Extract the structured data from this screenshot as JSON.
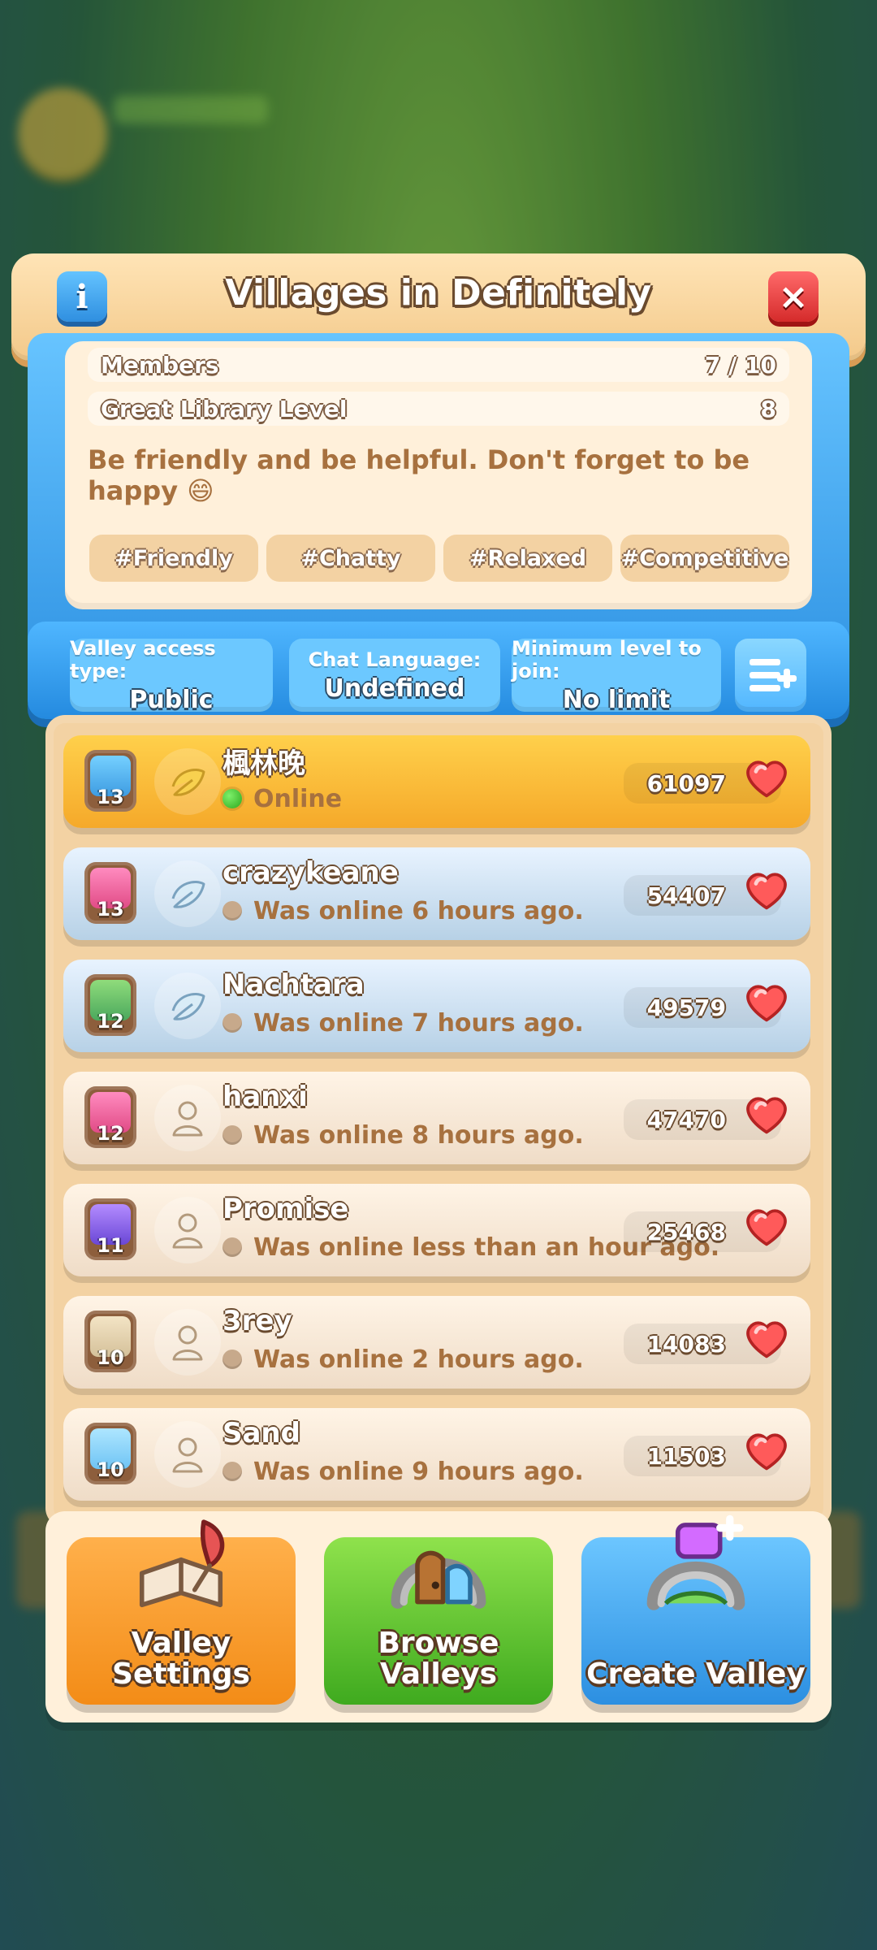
{
  "dialog": {
    "title": "Villages in Definitely",
    "info_button_label": "i",
    "close_button_label": "×",
    "stats": {
      "members_label": "Members",
      "members_value": "7 / 10",
      "library_label": "Great Library Level",
      "library_value": "8"
    },
    "motto": "Be friendly and be helpful. Don't forget to be happy 😄",
    "tags": [
      "#Friendly",
      "#Chatty",
      "#Relaxed",
      "#Competitive"
    ],
    "settings": {
      "access_label": "Valley access type:",
      "access_value": "Public",
      "chat_label": "Chat Language:",
      "chat_value": "Undefined",
      "min_label": "Minimum level to join:",
      "min_value": "No limit"
    },
    "members": [
      {
        "level": "13",
        "name": "楓林晚",
        "status": "Online",
        "score": "61097"
      },
      {
        "level": "13",
        "name": "crazykeane",
        "status": "Was online 6 hours ago.",
        "score": "54407"
      },
      {
        "level": "12",
        "name": "Nachtara",
        "status": "Was online 7 hours ago.",
        "score": "49579"
      },
      {
        "level": "12",
        "name": "hanxi",
        "status": "Was online 8 hours ago.",
        "score": "47470"
      },
      {
        "level": "11",
        "name": "Promise",
        "status": "Was online less than an hour ago.",
        "score": "25468"
      },
      {
        "level": "10",
        "name": "3rey",
        "status": "Was online 2 hours ago.",
        "score": "14083"
      },
      {
        "level": "10",
        "name": "Sand",
        "status": "Was online 9 hours ago.",
        "score": "11503"
      }
    ],
    "buttons": {
      "valley_settings": "Valley\nSettings",
      "browse_valleys": "Browse\nValleys",
      "create_valley": "Create Valley"
    }
  }
}
